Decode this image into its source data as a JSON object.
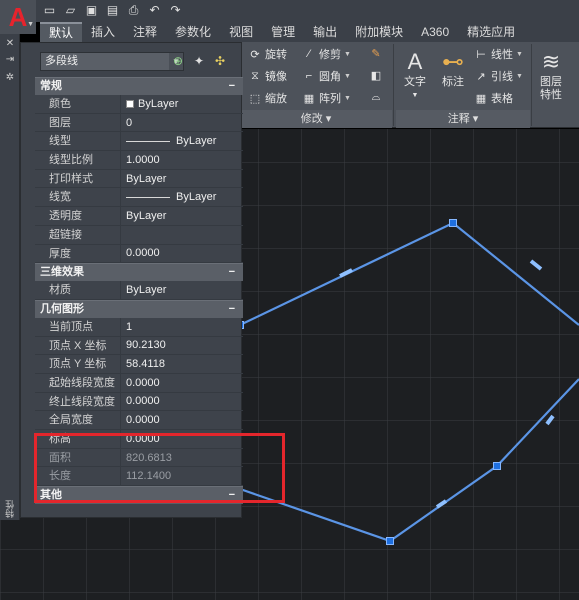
{
  "app": {
    "logo_letter": "A"
  },
  "qat": {
    "icons": [
      "new-icon",
      "open-icon",
      "save-icon",
      "saveas-icon",
      "print-icon",
      "undo-icon",
      "redo-icon"
    ]
  },
  "tabs": [
    {
      "label": "默认",
      "active": true
    },
    {
      "label": "插入"
    },
    {
      "label": "注释"
    },
    {
      "label": "参数化"
    },
    {
      "label": "视图"
    },
    {
      "label": "管理"
    },
    {
      "label": "输出"
    },
    {
      "label": "附加模块"
    },
    {
      "label": "A360"
    },
    {
      "label": "精选应用"
    }
  ],
  "ribbon": {
    "modify": {
      "rotate": "旋转",
      "trim": "修剪",
      "mirror": "镜像",
      "fillet": "圆角",
      "scale": "缩放",
      "array": "阵列",
      "panel_label": "修改"
    },
    "annotation": {
      "text": "文字",
      "dimension": "标注",
      "linear": "线性",
      "leader": "引线",
      "table": "表格",
      "panel_label": "注释"
    },
    "layers": {
      "layer_props_line1": "图层",
      "layer_props_line2": "特性"
    }
  },
  "palette": {
    "object_type": "多段线",
    "strip_title": "特性",
    "sections": {
      "general": {
        "title": "常规",
        "rows": [
          {
            "k": "颜色",
            "v": "ByLayer"
          },
          {
            "k": "图层",
            "v": "0"
          },
          {
            "k": "线型",
            "v": "ByLayer"
          },
          {
            "k": "线型比例",
            "v": "1.0000"
          },
          {
            "k": "打印样式",
            "v": "ByLayer"
          },
          {
            "k": "线宽",
            "v": "ByLayer"
          },
          {
            "k": "透明度",
            "v": "ByLayer"
          },
          {
            "k": "超链接",
            "v": ""
          },
          {
            "k": "厚度",
            "v": "0.0000"
          }
        ]
      },
      "3d": {
        "title": "三维效果",
        "rows": [
          {
            "k": "材质",
            "v": "ByLayer"
          }
        ]
      },
      "geometry": {
        "title": "几何图形",
        "rows": [
          {
            "k": "当前顶点",
            "v": "1"
          },
          {
            "k": "顶点 X 坐标",
            "v": "90.2130"
          },
          {
            "k": "顶点 Y 坐标",
            "v": "58.4118"
          },
          {
            "k": "起始线段宽度",
            "v": "0.0000"
          },
          {
            "k": "终止线段宽度",
            "v": "0.0000"
          },
          {
            "k": "全局宽度",
            "v": "0.0000"
          },
          {
            "k": "标高",
            "v": "0.0000"
          },
          {
            "k": "面积",
            "v": "820.6813"
          },
          {
            "k": "长度",
            "v": "112.1400"
          }
        ]
      },
      "other": {
        "title": "其他"
      }
    }
  },
  "colors": {
    "highlight": "#e4262c",
    "polyline": "#5b95e6",
    "grip": "#1e6fe0"
  }
}
